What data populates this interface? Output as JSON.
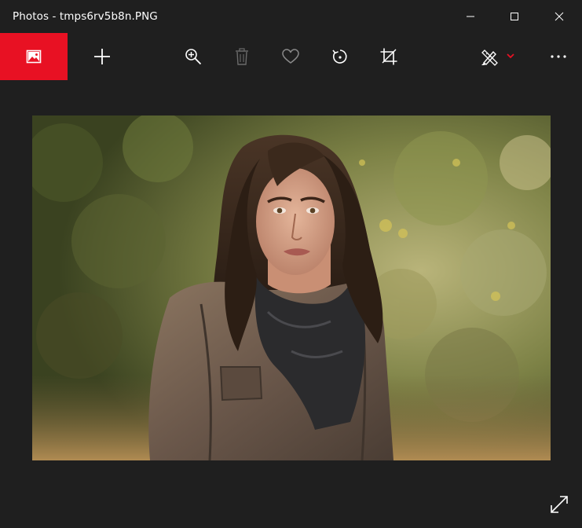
{
  "window": {
    "title": "Photos - tmps6rv5b8n.PNG",
    "controls": {
      "minimize_icon": "minimize-icon",
      "maximize_icon": "maximize-icon",
      "close_icon": "close-icon"
    }
  },
  "toolbar": {
    "accent_color": "#e81123",
    "items": [
      {
        "id": "home",
        "icon": "picture-icon"
      },
      {
        "id": "add",
        "icon": "plus-icon"
      },
      {
        "id": "zoom",
        "icon": "zoom-in-icon"
      },
      {
        "id": "delete",
        "icon": "trash-icon",
        "state": "disabled"
      },
      {
        "id": "favorite",
        "icon": "heart-icon"
      },
      {
        "id": "rotate",
        "icon": "rotate-icon"
      },
      {
        "id": "crop",
        "icon": "crop-icon"
      },
      {
        "id": "edit",
        "icon": "edit-draw-icon",
        "dropdown_icon": "chevron-down-icon"
      },
      {
        "id": "more",
        "icon": "more-icon"
      }
    ]
  },
  "viewer": {
    "image_subject": "photo of a woman with long dark hair in a brown leather jacket and dark scarf, outdoors with green foliage background",
    "fullscreen_icon": "expand-icon"
  },
  "colors": {
    "background": "#1f1f1f",
    "accent": "#e81123",
    "icon": "#ffffff",
    "icon_disabled": "#6b6b6b"
  }
}
